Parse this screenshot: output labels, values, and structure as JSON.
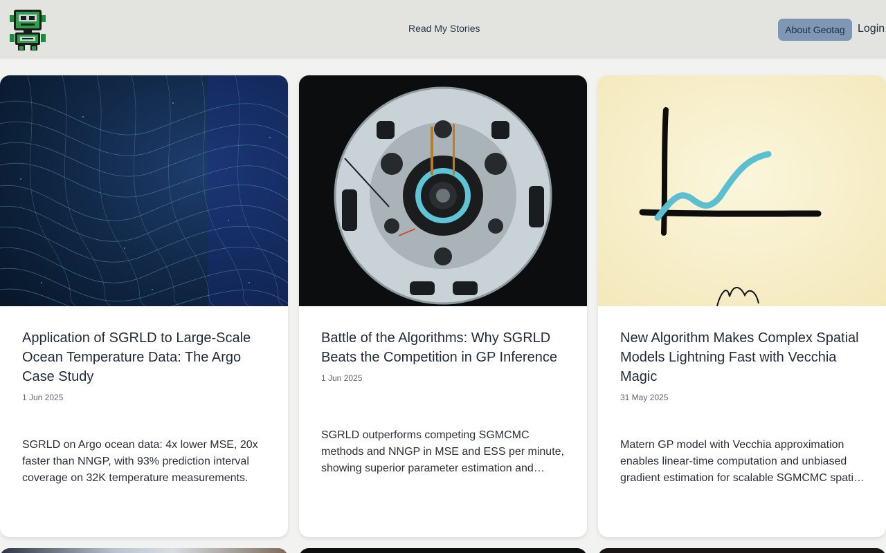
{
  "nav": {
    "logo_icon": "robot-logo-icon",
    "center_link": "Read My Stories",
    "about_button": "About Geotag",
    "login_link": "Login",
    "about_color": "#7f96b4"
  },
  "cards": [
    {
      "image": "blue-particle-wave-image",
      "title": "Application of SGRLD to Large-Scale Ocean Temperature Data: The Argo Case Study",
      "date": "1 Jun 2025",
      "description": "SGRLD on Argo ocean data: 4x lower MSE, 20x faster than NNGP, with 93% prediction interval coverage on 32K temperature measurements."
    },
    {
      "image": "circular-machine-image",
      "title": "Battle of the Algorithms: Why SGRLD Beats the Competition in GP Inference",
      "date": "1 Jun 2025",
      "description": "SGRLD outperforms competing SGMCMC methods and NNGP in MSE and ESS per minute, showing superior parameter estimation and computational efficiency."
    },
    {
      "image": "hand-drawn-graph-image",
      "title": "New Algorithm Makes Complex Spatial Models Lightning Fast with Vecchia Magic",
      "date": "31 May 2025",
      "description": "Matern GP model with Vecchia approximation enables linear-time computation and unbiased gradient estimation for scalable SGMCMC spatial inference."
    }
  ]
}
